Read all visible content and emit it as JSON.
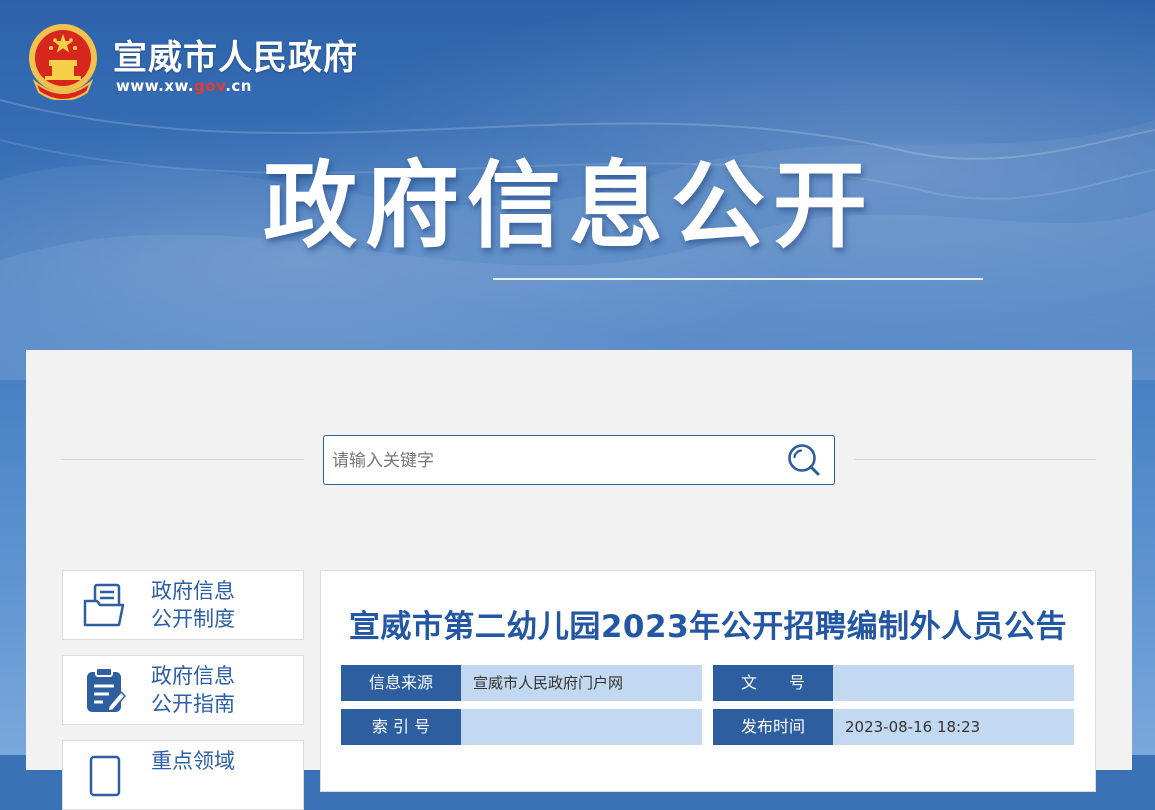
{
  "header": {
    "site_name": "宣威市人民政府",
    "url_prefix": "www.xw.",
    "url_gov": "gov",
    "url_suffix": ".cn",
    "hero_title": "政府信息公开"
  },
  "search": {
    "placeholder": "请输入关键字"
  },
  "sidebar": {
    "items": [
      {
        "line1": "政府信息",
        "line2": "公开制度",
        "icon": "folder-document-icon"
      },
      {
        "line1": "政府信息",
        "line2": "公开指南",
        "icon": "clipboard-edit-icon"
      },
      {
        "line1": "重点领域",
        "line2": "",
        "icon": "document-icon"
      }
    ]
  },
  "article": {
    "title": "宣威市第二幼儿园2023年公开招聘编制外人员公告",
    "meta": {
      "source_label": "信息来源",
      "source_value": "宣威市人民政府门户网",
      "doc_no_label": "文　　号",
      "doc_no_value": "",
      "index_label": "索 引 号",
      "index_value": "",
      "publish_label": "发布时间",
      "publish_value": "2023-08-16 18:23"
    }
  },
  "colors": {
    "brand_blue": "#2d5fa0",
    "title_blue": "#2357a3",
    "meta_value_bg": "#c3d8f1",
    "gov_red": "#e23b2f"
  }
}
